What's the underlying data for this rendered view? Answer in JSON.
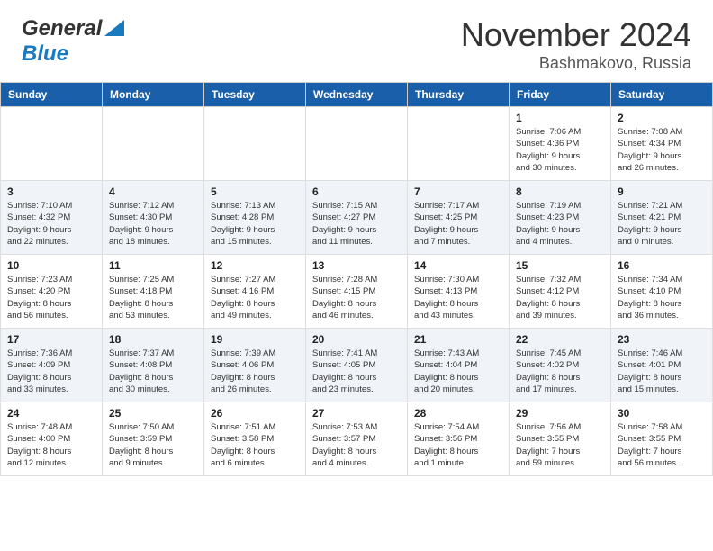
{
  "header": {
    "logo_general": "General",
    "logo_blue": "Blue",
    "title": "November 2024",
    "subtitle": "Bashmakovo, Russia"
  },
  "days_of_week": [
    "Sunday",
    "Monday",
    "Tuesday",
    "Wednesday",
    "Thursday",
    "Friday",
    "Saturday"
  ],
  "weeks": [
    {
      "row_shade": "white",
      "days": [
        {
          "num": "",
          "info": ""
        },
        {
          "num": "",
          "info": ""
        },
        {
          "num": "",
          "info": ""
        },
        {
          "num": "",
          "info": ""
        },
        {
          "num": "",
          "info": ""
        },
        {
          "num": "1",
          "info": "Sunrise: 7:06 AM\nSunset: 4:36 PM\nDaylight: 9 hours\nand 30 minutes."
        },
        {
          "num": "2",
          "info": "Sunrise: 7:08 AM\nSunset: 4:34 PM\nDaylight: 9 hours\nand 26 minutes."
        }
      ]
    },
    {
      "row_shade": "shaded",
      "days": [
        {
          "num": "3",
          "info": "Sunrise: 7:10 AM\nSunset: 4:32 PM\nDaylight: 9 hours\nand 22 minutes."
        },
        {
          "num": "4",
          "info": "Sunrise: 7:12 AM\nSunset: 4:30 PM\nDaylight: 9 hours\nand 18 minutes."
        },
        {
          "num": "5",
          "info": "Sunrise: 7:13 AM\nSunset: 4:28 PM\nDaylight: 9 hours\nand 15 minutes."
        },
        {
          "num": "6",
          "info": "Sunrise: 7:15 AM\nSunset: 4:27 PM\nDaylight: 9 hours\nand 11 minutes."
        },
        {
          "num": "7",
          "info": "Sunrise: 7:17 AM\nSunset: 4:25 PM\nDaylight: 9 hours\nand 7 minutes."
        },
        {
          "num": "8",
          "info": "Sunrise: 7:19 AM\nSunset: 4:23 PM\nDaylight: 9 hours\nand 4 minutes."
        },
        {
          "num": "9",
          "info": "Sunrise: 7:21 AM\nSunset: 4:21 PM\nDaylight: 9 hours\nand 0 minutes."
        }
      ]
    },
    {
      "row_shade": "white",
      "days": [
        {
          "num": "10",
          "info": "Sunrise: 7:23 AM\nSunset: 4:20 PM\nDaylight: 8 hours\nand 56 minutes."
        },
        {
          "num": "11",
          "info": "Sunrise: 7:25 AM\nSunset: 4:18 PM\nDaylight: 8 hours\nand 53 minutes."
        },
        {
          "num": "12",
          "info": "Sunrise: 7:27 AM\nSunset: 4:16 PM\nDaylight: 8 hours\nand 49 minutes."
        },
        {
          "num": "13",
          "info": "Sunrise: 7:28 AM\nSunset: 4:15 PM\nDaylight: 8 hours\nand 46 minutes."
        },
        {
          "num": "14",
          "info": "Sunrise: 7:30 AM\nSunset: 4:13 PM\nDaylight: 8 hours\nand 43 minutes."
        },
        {
          "num": "15",
          "info": "Sunrise: 7:32 AM\nSunset: 4:12 PM\nDaylight: 8 hours\nand 39 minutes."
        },
        {
          "num": "16",
          "info": "Sunrise: 7:34 AM\nSunset: 4:10 PM\nDaylight: 8 hours\nand 36 minutes."
        }
      ]
    },
    {
      "row_shade": "shaded",
      "days": [
        {
          "num": "17",
          "info": "Sunrise: 7:36 AM\nSunset: 4:09 PM\nDaylight: 8 hours\nand 33 minutes."
        },
        {
          "num": "18",
          "info": "Sunrise: 7:37 AM\nSunset: 4:08 PM\nDaylight: 8 hours\nand 30 minutes."
        },
        {
          "num": "19",
          "info": "Sunrise: 7:39 AM\nSunset: 4:06 PM\nDaylight: 8 hours\nand 26 minutes."
        },
        {
          "num": "20",
          "info": "Sunrise: 7:41 AM\nSunset: 4:05 PM\nDaylight: 8 hours\nand 23 minutes."
        },
        {
          "num": "21",
          "info": "Sunrise: 7:43 AM\nSunset: 4:04 PM\nDaylight: 8 hours\nand 20 minutes."
        },
        {
          "num": "22",
          "info": "Sunrise: 7:45 AM\nSunset: 4:02 PM\nDaylight: 8 hours\nand 17 minutes."
        },
        {
          "num": "23",
          "info": "Sunrise: 7:46 AM\nSunset: 4:01 PM\nDaylight: 8 hours\nand 15 minutes."
        }
      ]
    },
    {
      "row_shade": "white",
      "days": [
        {
          "num": "24",
          "info": "Sunrise: 7:48 AM\nSunset: 4:00 PM\nDaylight: 8 hours\nand 12 minutes."
        },
        {
          "num": "25",
          "info": "Sunrise: 7:50 AM\nSunset: 3:59 PM\nDaylight: 8 hours\nand 9 minutes."
        },
        {
          "num": "26",
          "info": "Sunrise: 7:51 AM\nSunset: 3:58 PM\nDaylight: 8 hours\nand 6 minutes."
        },
        {
          "num": "27",
          "info": "Sunrise: 7:53 AM\nSunset: 3:57 PM\nDaylight: 8 hours\nand 4 minutes."
        },
        {
          "num": "28",
          "info": "Sunrise: 7:54 AM\nSunset: 3:56 PM\nDaylight: 8 hours\nand 1 minute."
        },
        {
          "num": "29",
          "info": "Sunrise: 7:56 AM\nSunset: 3:55 PM\nDaylight: 7 hours\nand 59 minutes."
        },
        {
          "num": "30",
          "info": "Sunrise: 7:58 AM\nSunset: 3:55 PM\nDaylight: 7 hours\nand 56 minutes."
        }
      ]
    }
  ]
}
